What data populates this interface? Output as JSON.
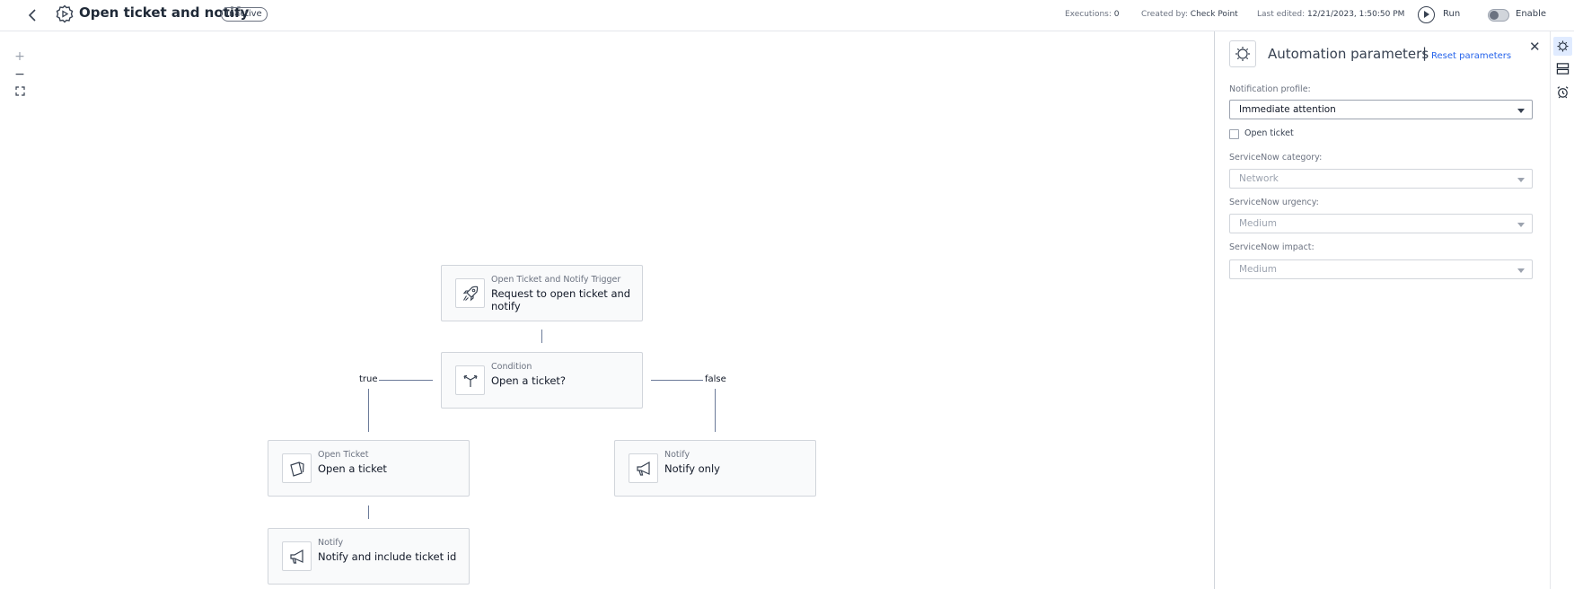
{
  "header": {
    "title": "Open ticket and notify",
    "status": "Inactive",
    "executions_label": "Executions:",
    "executions_value": "0",
    "created_label": "Created by:",
    "created_value": "Check Point",
    "edited_label": "Last edited:",
    "edited_value": "12/21/2023, 1:50:50 PM",
    "run_label": "Run",
    "enable_label": "Enable"
  },
  "zoom": {
    "in": "+",
    "out": "−",
    "fit": "⛶"
  },
  "flow": {
    "trigger": {
      "type": "Open Ticket and Notify Trigger",
      "label": "Request to open ticket and notify"
    },
    "condition": {
      "type": "Condition",
      "label": "Open a ticket?"
    },
    "true_label": "true",
    "false_label": "false",
    "open_ticket": {
      "type": "Open Ticket",
      "label": "Open a ticket"
    },
    "notify_only": {
      "type": "Notify",
      "label": "Notify only"
    },
    "notify_ticket": {
      "type": "Notify",
      "label": "Notify and include ticket id"
    }
  },
  "panel": {
    "title": "Automation parameters",
    "separator": "|",
    "reset": "Reset parameters",
    "close": "✕",
    "notification_profile_label": "Notification profile:",
    "notification_profile_value": "Immediate attention",
    "open_ticket_label": "Open ticket",
    "category_label": "ServiceNow category:",
    "category_value": "Network",
    "urgency_label": "ServiceNow urgency:",
    "urgency_value": "Medium",
    "impact_label": "ServiceNow impact:",
    "impact_value": "Medium"
  }
}
